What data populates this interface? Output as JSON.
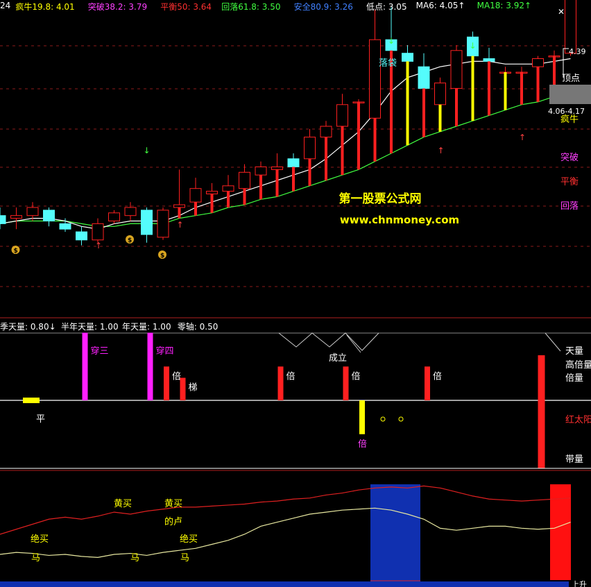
{
  "header": {
    "items": [
      {
        "label": "24",
        "color": "#ffffff"
      },
      {
        "label": "疯牛19.8: 4.01",
        "color": "#ffff00"
      },
      {
        "label": "突破38.2: 3.79",
        "color": "#ff40ff"
      },
      {
        "label": "平衡50: 3.64",
        "color": "#ff3030"
      },
      {
        "label": "回落61.8: 3.50",
        "color": "#40ff40"
      },
      {
        "label": "安全80.9: 3.26",
        "color": "#4080ff"
      },
      {
        "label": "低点: 3.05",
        "color": "#ffffff"
      },
      {
        "label": "MA6: 4.05↑",
        "color": "#ffffff"
      },
      {
        "label": "MA18: 3.92↑",
        "color": "#40ff40"
      }
    ],
    "close_glyph": "✕"
  },
  "sub_header": {
    "items": [
      {
        "label": "季天量: 0.80↓",
        "color": "#ffffff"
      },
      {
        "label": "半年天量: 1.00",
        "color": "#ffffff"
      },
      {
        "label": "年天量: 1.00",
        "color": "#ffffff"
      },
      {
        "label": "零轴: 0.50",
        "color": "#ffffff"
      }
    ]
  },
  "main_labels": {
    "luodai": "落袋",
    "price_high": "4.39",
    "dingdian": "顶点",
    "price_range": "4.06-4.17",
    "fengniu": "疯牛",
    "tupo": "突破",
    "pingheng": "平衡",
    "huiluo": "回落"
  },
  "watermark": {
    "line1": "第一股票公式网",
    "line2": "www.chnmoney.com"
  },
  "panel2_labels": {
    "chuan_san": "穿三",
    "chuan_si": "穿四",
    "bei": "倍",
    "ti": "梯",
    "ping": "平",
    "chengli": "成立",
    "tianliang": "天量",
    "gaobeiliang": "高倍量",
    "beiliang": "倍量",
    "hongtaiyang": "红太阳",
    "dailiang": "带量"
  },
  "panel3_labels": {
    "huangmai": "黄买",
    "delu": "的卢",
    "juemai": "绝买",
    "ma": "马",
    "bottom_right": "上升"
  },
  "colors": {
    "up": "#ff2020",
    "down": "#54fcfc",
    "ma6": "#ffffff",
    "ma18": "#40ff40",
    "yellow": "#ffff00",
    "magenta": "#ff20ff",
    "blue": "#1030b0",
    "grid": "#8b1a1a"
  },
  "chart_data": [
    {
      "type": "candlestick",
      "name": "main",
      "candles": [
        {
          "o": 3.47,
          "h": 3.5,
          "l": 3.42,
          "c": 3.44
        },
        {
          "o": 3.46,
          "h": 3.5,
          "l": 3.42,
          "c": 3.47
        },
        {
          "o": 3.47,
          "h": 3.52,
          "l": 3.45,
          "c": 3.5
        },
        {
          "o": 3.49,
          "h": 3.5,
          "l": 3.43,
          "c": 3.45
        },
        {
          "o": 3.44,
          "h": 3.46,
          "l": 3.41,
          "c": 3.42
        },
        {
          "o": 3.41,
          "h": 3.43,
          "l": 3.36,
          "c": 3.38
        },
        {
          "o": 3.38,
          "h": 3.46,
          "l": 3.37,
          "c": 3.44
        },
        {
          "o": 3.45,
          "h": 3.49,
          "l": 3.44,
          "c": 3.48
        },
        {
          "o": 3.47,
          "h": 3.52,
          "l": 3.45,
          "c": 3.5
        },
        {
          "o": 3.49,
          "h": 3.5,
          "l": 3.37,
          "c": 3.4
        },
        {
          "o": 3.39,
          "h": 3.5,
          "l": 3.38,
          "c": 3.49
        },
        {
          "o": 3.5,
          "h": 3.64,
          "l": 3.47,
          "c": 3.51
        },
        {
          "o": 3.52,
          "h": 3.61,
          "l": 3.51,
          "c": 3.57
        },
        {
          "o": 3.55,
          "h": 3.59,
          "l": 3.52,
          "c": 3.56
        },
        {
          "o": 3.56,
          "h": 3.62,
          "l": 3.54,
          "c": 3.58
        },
        {
          "o": 3.57,
          "h": 3.66,
          "l": 3.55,
          "c": 3.63
        },
        {
          "o": 3.62,
          "h": 3.67,
          "l": 3.6,
          "c": 3.65
        },
        {
          "o": 3.64,
          "h": 3.7,
          "l": 3.59,
          "c": 3.65
        },
        {
          "o": 3.68,
          "h": 3.7,
          "l": 3.64,
          "c": 3.65
        },
        {
          "o": 3.68,
          "h": 3.79,
          "l": 3.67,
          "c": 3.76
        },
        {
          "o": 3.76,
          "h": 3.82,
          "l": 3.74,
          "c": 3.8
        },
        {
          "o": 3.8,
          "h": 3.92,
          "l": 3.79,
          "c": 3.88
        },
        {
          "o": 3.89,
          "h": 3.9,
          "l": 3.88,
          "c": 3.89
        },
        {
          "o": 3.83,
          "h": 4.23,
          "l": 3.82,
          "c": 4.12
        },
        {
          "o": 4.12,
          "h": 4.24,
          "l": 4.05,
          "c": 4.08
        },
        {
          "o": 4.07,
          "h": 4.1,
          "l": 4.01,
          "c": 4.04
        },
        {
          "o": 4.02,
          "h": 4.07,
          "l": 3.87,
          "c": 3.94
        },
        {
          "o": 3.88,
          "h": 3.98,
          "l": 3.87,
          "c": 3.96
        },
        {
          "o": 3.94,
          "h": 4.1,
          "l": 3.92,
          "c": 4.08
        },
        {
          "o": 4.13,
          "h": 4.15,
          "l": 4.04,
          "c": 4.06
        },
        {
          "o": 4.05,
          "h": 4.09,
          "l": 4.03,
          "c": 4.04
        },
        {
          "o": 4.0,
          "h": 4.02,
          "l": 3.98,
          "c": 4.0
        },
        {
          "o": 4.0,
          "h": 4.02,
          "l": 3.98,
          "c": 4.0
        },
        {
          "o": 4.02,
          "h": 4.06,
          "l": 4.0,
          "c": 4.05
        },
        {
          "o": 4.06,
          "h": 4.08,
          "l": 4.03,
          "c": 4.06
        },
        {
          "o": 4.07,
          "h": 4.39,
          "l": 4.06,
          "c": 4.27
        }
      ],
      "ma6": [
        3.44,
        3.45,
        3.46,
        3.46,
        3.45,
        3.43,
        3.42,
        3.44,
        3.45,
        3.45,
        3.45,
        3.47,
        3.5,
        3.52,
        3.54,
        3.56,
        3.58,
        3.6,
        3.62,
        3.64,
        3.68,
        3.73,
        3.78,
        3.85,
        3.93,
        3.98,
        4.0,
        4.02,
        4.03,
        4.04,
        4.04,
        4.03,
        4.03,
        4.03,
        4.04,
        4.05
      ],
      "ma18": [
        3.44,
        3.45,
        3.45,
        3.45,
        3.45,
        3.44,
        3.43,
        3.43,
        3.44,
        3.44,
        3.44,
        3.46,
        3.47,
        3.48,
        3.5,
        3.51,
        3.53,
        3.54,
        3.56,
        3.58,
        3.6,
        3.62,
        3.64,
        3.67,
        3.7,
        3.73,
        3.76,
        3.78,
        3.8,
        3.82,
        3.84,
        3.86,
        3.88,
        3.89,
        3.91,
        3.92
      ],
      "levels": [
        4.01,
        3.79,
        3.64,
        3.5,
        3.26,
        3.05
      ]
    },
    {
      "type": "bar",
      "name": "volume_signals",
      "bars": [
        {
          "i": 5,
          "value": 3.0,
          "color": "magenta",
          "label": "穿三"
        },
        {
          "i": 9,
          "value": 3.0,
          "color": "magenta",
          "label": "穿四"
        },
        {
          "i": 10,
          "value": 1.5,
          "color": "red",
          "label": "倍"
        },
        {
          "i": 11,
          "value": 1.0,
          "color": "red",
          "label": "梯"
        },
        {
          "i": 17,
          "value": 1.5,
          "color": "red",
          "label": "倍"
        },
        {
          "i": 21,
          "value": 1.5,
          "color": "red",
          "label": "倍"
        },
        {
          "i": 22,
          "value": -1.5,
          "color": "yellow",
          "label": "倍"
        },
        {
          "i": 26,
          "value": 1.5,
          "color": "red",
          "label": "倍"
        },
        {
          "i": 33,
          "value": 2.0,
          "color": "red"
        },
        {
          "i": 33,
          "value": -3.0,
          "color": "red"
        }
      ],
      "flat": {
        "i": 1,
        "value": 0,
        "label": "平"
      }
    },
    {
      "type": "line",
      "name": "oscillator",
      "series": [
        {
          "color": "red",
          "values": [
            40,
            45,
            50,
            55,
            57,
            55,
            58,
            62,
            60,
            63,
            65,
            67,
            67,
            68,
            69,
            70,
            72,
            73,
            75,
            76,
            79,
            81,
            84,
            86,
            87,
            86,
            88,
            86,
            82,
            78,
            75,
            74,
            73,
            74,
            75,
            76
          ]
        },
        {
          "color": "yellow",
          "values": [
            20,
            22,
            21,
            19,
            20,
            18,
            17,
            20,
            21,
            19,
            22,
            24,
            26,
            30,
            34,
            40,
            48,
            52,
            56,
            60,
            62,
            64,
            65,
            66,
            64,
            60,
            55,
            46,
            44,
            46,
            48,
            48,
            46,
            45,
            46,
            52
          ]
        }
      ],
      "blocks": [
        {
          "from": 22,
          "to": 24,
          "color": "blue"
        },
        {
          "from": 33,
          "to": 33,
          "color": "red"
        }
      ]
    }
  ]
}
